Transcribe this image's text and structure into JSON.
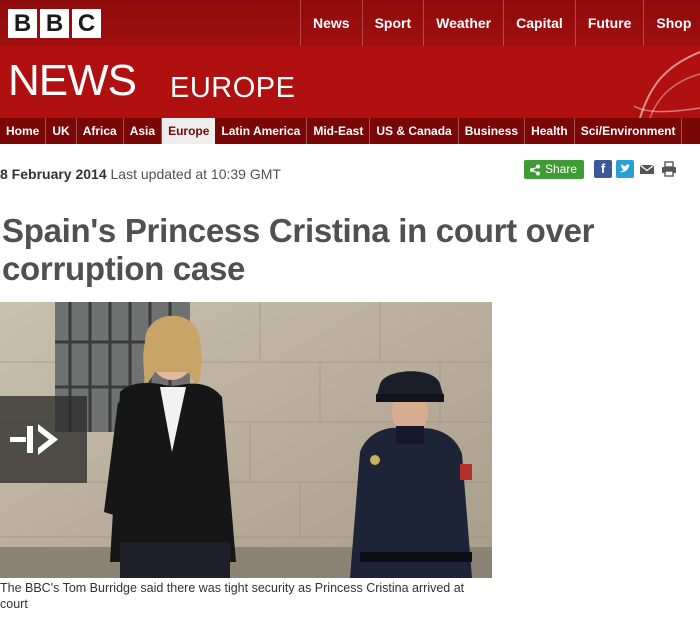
{
  "brand": {
    "logo_letters": [
      "B",
      "B",
      "C"
    ]
  },
  "top_nav": [
    "News",
    "Sport",
    "Weather",
    "Capital",
    "Future",
    "Shop"
  ],
  "banner": {
    "title": "NEWS",
    "edition": "EUROPE"
  },
  "section_nav": {
    "items": [
      "Home",
      "UK",
      "Africa",
      "Asia",
      "Europe",
      "Latin America",
      "Mid-East",
      "US & Canada",
      "Business",
      "Health",
      "Sci/Environment"
    ],
    "active": "Europe"
  },
  "article": {
    "date": "8 February 2014",
    "updated": "Last updated at 10:39 GMT",
    "headline": "Spain's Princess Cristina in court over corruption case",
    "caption": "The BBC's Tom Burridge said there was tight security as Princess Cristina arrived at court"
  },
  "share": {
    "label": "Share",
    "icons": [
      "facebook-icon",
      "twitter-icon",
      "email-icon",
      "print-icon"
    ]
  },
  "colors": {
    "brand_red": "#b01010",
    "nav_dark_red": "#7a0606",
    "share_green": "#3f9b33",
    "headline_gray": "#505050"
  }
}
